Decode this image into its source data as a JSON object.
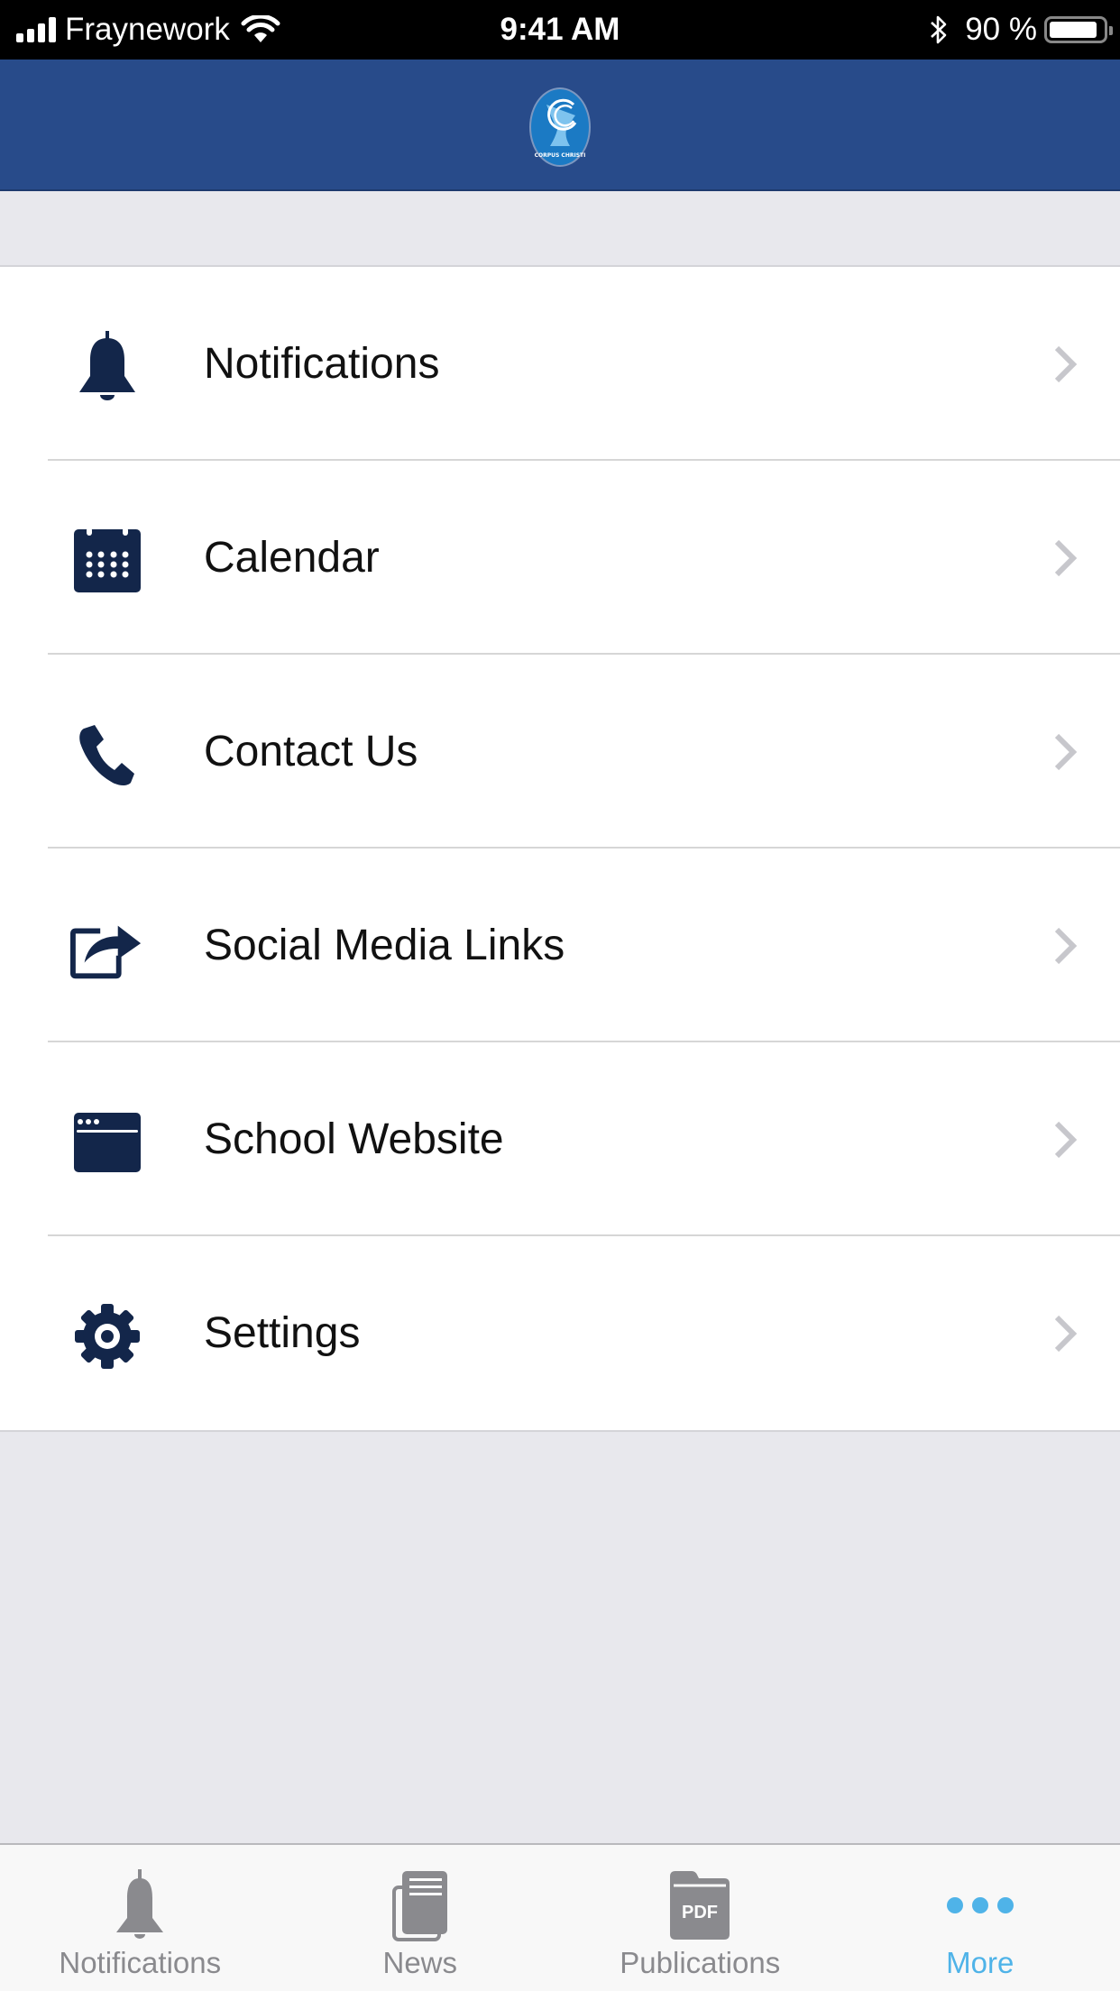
{
  "status_bar": {
    "carrier": "Fraynework",
    "time": "9:41 AM",
    "battery_percent_label": "90 %",
    "battery_level": 0.9,
    "icons": [
      "signal-icon",
      "wifi-icon",
      "bluetooth-icon",
      "battery-icon"
    ]
  },
  "header": {
    "logo": "corpus-christi-logo",
    "logo_text": "CORPUS CHRISTI"
  },
  "colors": {
    "nav_bar": "#284b8a",
    "icon_navy": "#13264a",
    "tab_active": "#4fb3e8",
    "tab_inactive": "#8a8a8e",
    "chevron": "#c7c7cc",
    "background": "#e8e8ed"
  },
  "menu": {
    "items": [
      {
        "label": "Notifications",
        "icon": "bell-icon"
      },
      {
        "label": "Calendar",
        "icon": "calendar-icon"
      },
      {
        "label": "Contact Us",
        "icon": "phone-icon"
      },
      {
        "label": "Social Media Links",
        "icon": "share-icon"
      },
      {
        "label": "School Website",
        "icon": "browser-window-icon"
      },
      {
        "label": "Settings",
        "icon": "gear-icon"
      }
    ]
  },
  "tab_bar": {
    "tabs": [
      {
        "label": "Notifications",
        "icon": "bell-icon",
        "active": false
      },
      {
        "label": "News",
        "icon": "newspaper-icon",
        "active": false
      },
      {
        "label": "Publications",
        "icon": "pdf-folder-icon",
        "icon_text": "PDF",
        "active": false
      },
      {
        "label": "More",
        "icon": "more-dots-icon",
        "active": true
      }
    ]
  }
}
